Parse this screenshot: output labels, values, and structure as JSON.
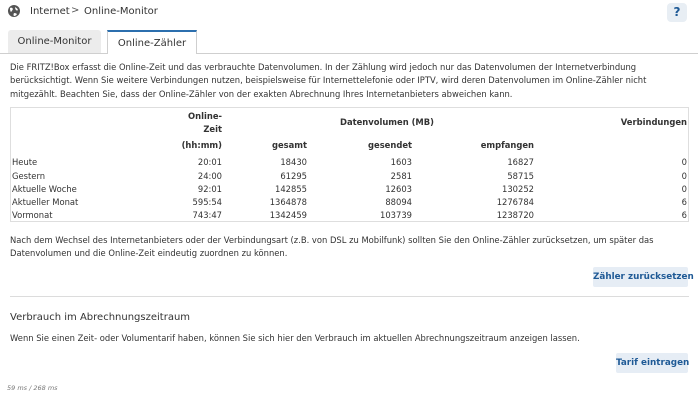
{
  "breadcrumb": {
    "root": "Internet",
    "separator": ">",
    "current": "Online-Monitor"
  },
  "help_label": "?",
  "tabs": [
    {
      "label": "Online-Monitor",
      "active": false
    },
    {
      "label": "Online-Zähler",
      "active": true
    }
  ],
  "intro_text": "Die FRITZ!Box erfasst die Online-Zeit und das verbrauchte Datenvolumen. In der Zählung wird jedoch nur das Datenvolumen der Internetverbindung berücksichtigt. Wenn Sie weitere Verbindungen nutzen, beispielsweise für Internettelefonie oder IPTV, wird deren Datenvolumen im Online-Zähler nicht mitgezählt. Beachten Sie, dass der Online-Zähler von der exakten Abrechnung Ihres Internetanbieters abweichen kann.",
  "table": {
    "header_online_line1": "Online-",
    "header_online_line2": "Zeit",
    "header_online_unit": "(hh:mm)",
    "header_volume": "Datenvolumen (MB)",
    "header_total": "gesamt",
    "header_sent": "gesendet",
    "header_received": "empfangen",
    "header_connections": "Verbindungen",
    "rows": [
      {
        "label": "Heute",
        "time": "20:01",
        "total": "18430",
        "sent": "1603",
        "received": "16827",
        "connections": "0"
      },
      {
        "label": "Gestern",
        "time": "24:00",
        "total": "61295",
        "sent": "2581",
        "received": "58715",
        "connections": "0"
      },
      {
        "label": "Aktuelle Woche",
        "time": "92:01",
        "total": "142855",
        "sent": "12603",
        "received": "130252",
        "connections": "0"
      },
      {
        "label": "Aktueller Monat",
        "time": "595:54",
        "total": "1364878",
        "sent": "88094",
        "received": "1276784",
        "connections": "6"
      },
      {
        "label": "Vormonat",
        "time": "743:47",
        "total": "1342459",
        "sent": "103739",
        "received": "1238720",
        "connections": "6"
      }
    ]
  },
  "reset_note": "Nach dem Wechsel des Internetanbieters oder der Verbindungsart (z.B. von DSL zu Mobilfunk) sollten Sie den Online-Zähler zurücksetzen, um später das Datenvolumen und die Online-Zeit eindeutig zuordnen zu können.",
  "reset_button": "Zähler zurücksetzen",
  "section": {
    "title": "Verbrauch im Abrechnungszeitraum",
    "text": "Wenn Sie einen Zeit- oder Volumentarif haben, können Sie sich hier den Verbrauch im aktuellen Abrechnungszeitraum anzeigen lassen.",
    "button": "Tarif eintragen"
  },
  "timing": "59 ms / 268 ms",
  "colors": {
    "accent": "#2c6fae",
    "button_bg": "#e6edf5",
    "button_text": "#1f5a96"
  }
}
